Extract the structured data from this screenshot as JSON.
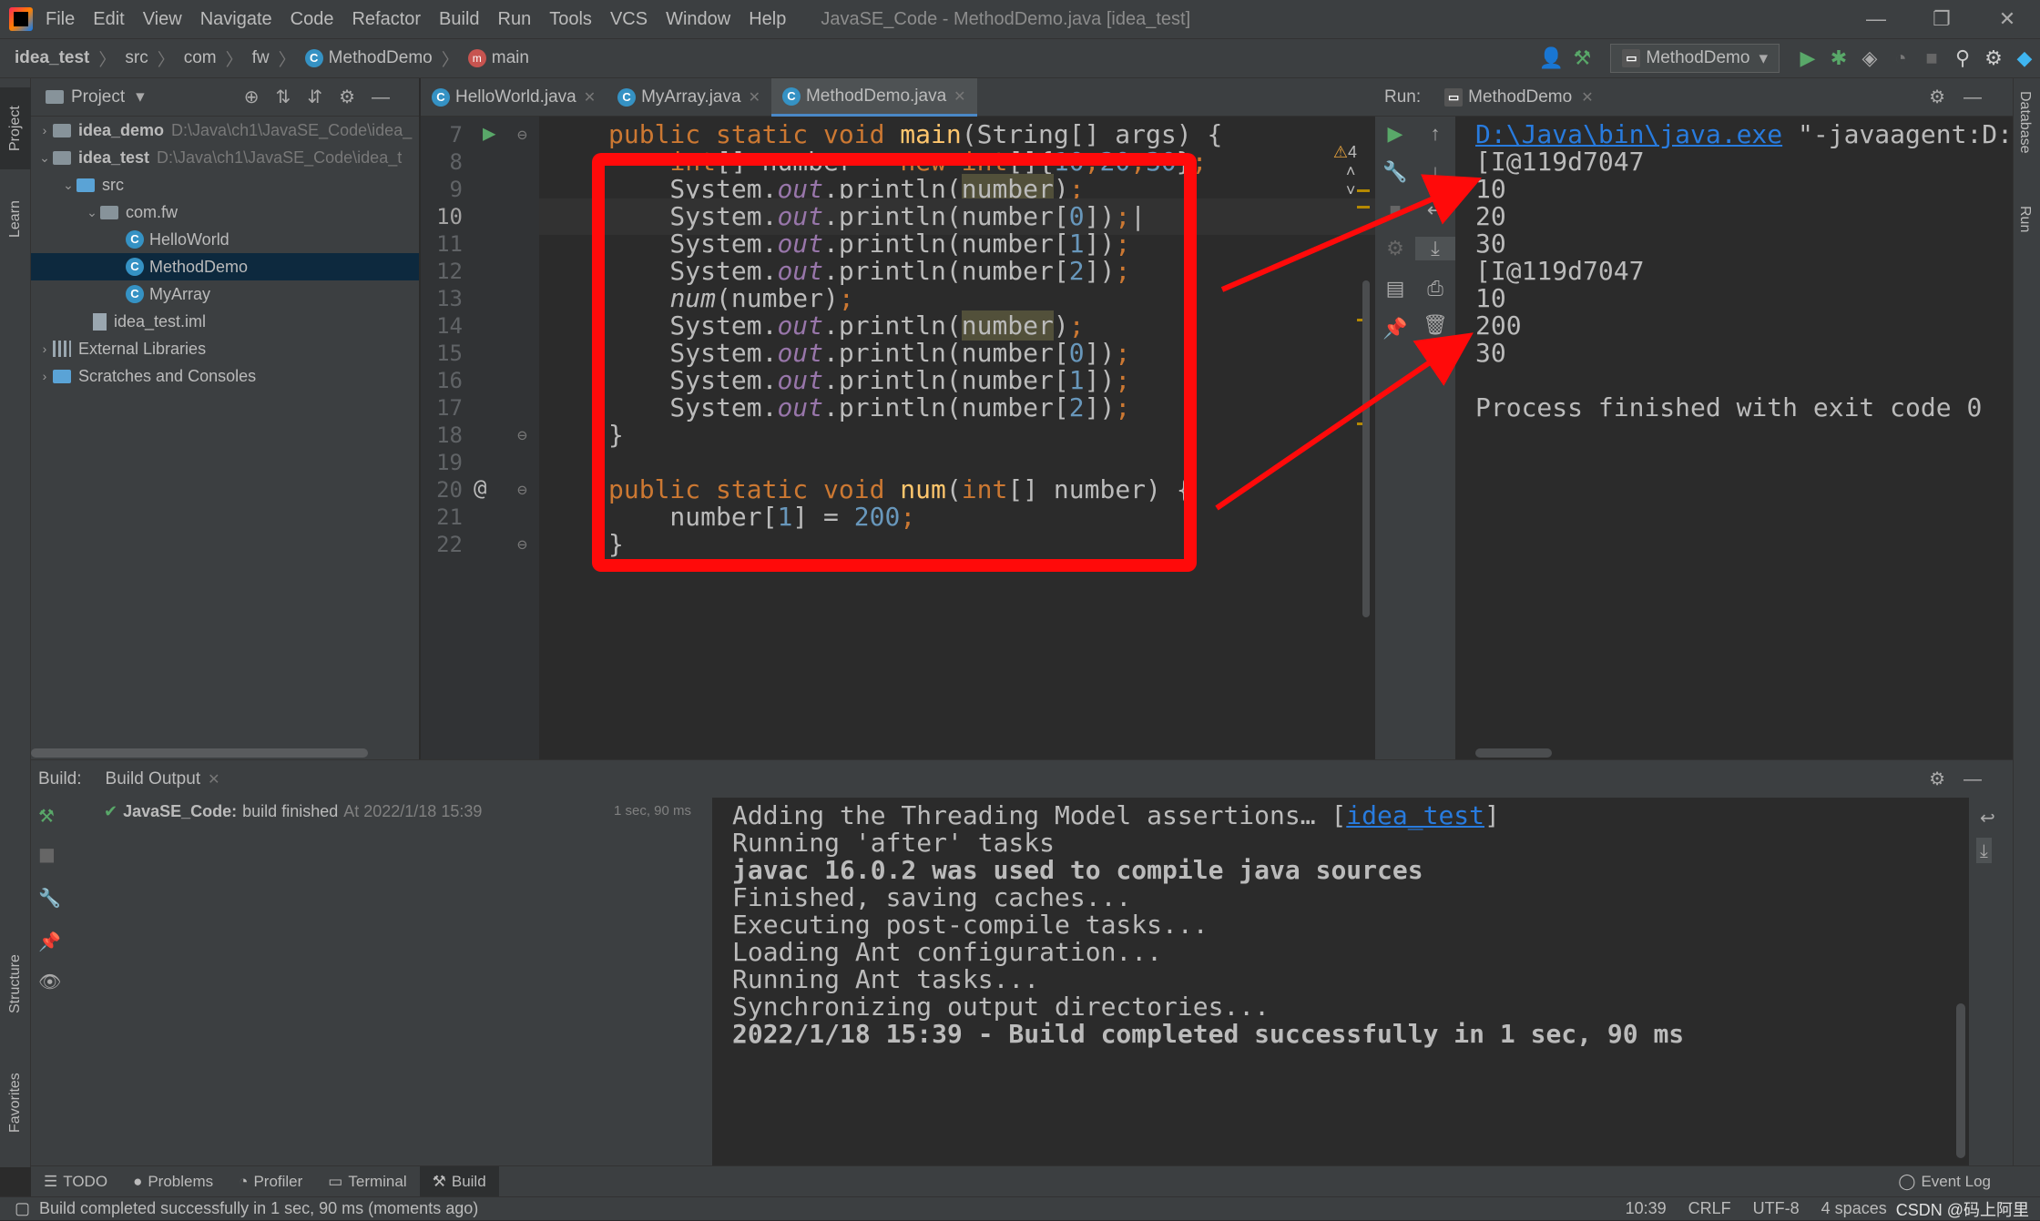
{
  "window": {
    "title": "JavaSE_Code - MethodDemo.java [idea_test]",
    "menu": [
      "File",
      "Edit",
      "View",
      "Navigate",
      "Code",
      "Refactor",
      "Build",
      "Run",
      "Tools",
      "VCS",
      "Window",
      "Help"
    ],
    "controls": {
      "minimize": "—",
      "restore": "❐",
      "close": "✕"
    }
  },
  "breadcrumb": {
    "items": [
      "idea_test",
      "src",
      "com",
      "fw",
      "MethodDemo",
      "main"
    ]
  },
  "toolbar": {
    "run_config": "MethodDemo"
  },
  "left_stripe": {
    "project": "Project",
    "learn": "Learn",
    "structure": "Structure",
    "favorites": "Favorites"
  },
  "right_stripe": {
    "database": "Database",
    "run": "Run"
  },
  "project_panel": {
    "title": "Project",
    "tree": [
      {
        "label": "idea_demo",
        "path": "D:\\Java\\ch1\\JavaSE_Code\\idea_",
        "bold": true
      },
      {
        "label": "idea_test",
        "path": "D:\\Java\\ch1\\JavaSE_Code\\idea_t",
        "bold": true
      },
      {
        "label": "src"
      },
      {
        "label": "com.fw"
      },
      {
        "label": "HelloWorld"
      },
      {
        "label": "MethodDemo"
      },
      {
        "label": "MyArray"
      },
      {
        "label": "idea_test.iml"
      },
      {
        "label": "External Libraries"
      },
      {
        "label": "Scratches and Consoles"
      }
    ]
  },
  "editor": {
    "tabs": [
      "HelloWorld.java",
      "MyArray.java",
      "MethodDemo.java"
    ],
    "active_tab": "MethodDemo.java",
    "warnings": "4",
    "line_numbers": [
      "7",
      "8",
      "9",
      "10",
      "11",
      "12",
      "13",
      "14",
      "15",
      "16",
      "17",
      "18",
      "19",
      "20",
      "21",
      "22"
    ]
  },
  "run_panel": {
    "label": "Run:",
    "tab": "MethodDemo",
    "output": {
      "cmd_link": "D:\\Java\\bin\\java.exe",
      "cmd_rest": " \"-javaagent:D:\\J",
      "lines": [
        "[I@119d7047",
        "10",
        "20",
        "30",
        "[I@119d7047",
        "10",
        "200",
        "30",
        "",
        "Process finished with exit code 0"
      ]
    }
  },
  "build_panel": {
    "label": "Build:",
    "tab": "Build Output",
    "summary": {
      "project": "JavaSE_Code:",
      "status": "build finished",
      "time": "At 2022/1/18 15:39",
      "duration": "1 sec, 90 ms"
    },
    "threading_text": "Adding the Threading Model assertions… [",
    "threading_link": "idea_test",
    "threading_end": "]",
    "output": [
      "Running 'after' tasks",
      "javac 16.0.2 was used to compile java sources",
      "Finished, saving caches...",
      "Executing post-compile tasks...",
      "Loading Ant configuration...",
      "Running Ant tasks...",
      "Synchronizing output directories...",
      "2022/1/18 15:39 - Build completed successfully in 1 sec, 90 ms"
    ]
  },
  "bottom_tabs": [
    "TODO",
    "Problems",
    "Profiler",
    "Terminal",
    "Build"
  ],
  "event_log": "Event Log",
  "status": {
    "message": "Build completed successfully in 1 sec, 90 ms (moments ago)",
    "position": "10:39",
    "line_sep": "CRLF",
    "encoding": "UTF-8",
    "indent": "4 spaces",
    "watermark": "CSDN @码上阿里"
  },
  "colors": {
    "keyword": "#cc7832",
    "function": "#ffc66d",
    "number": "#6897bb",
    "field": "#9876aa",
    "highlight_box": "#ff0a0a",
    "link": "#287bde"
  }
}
